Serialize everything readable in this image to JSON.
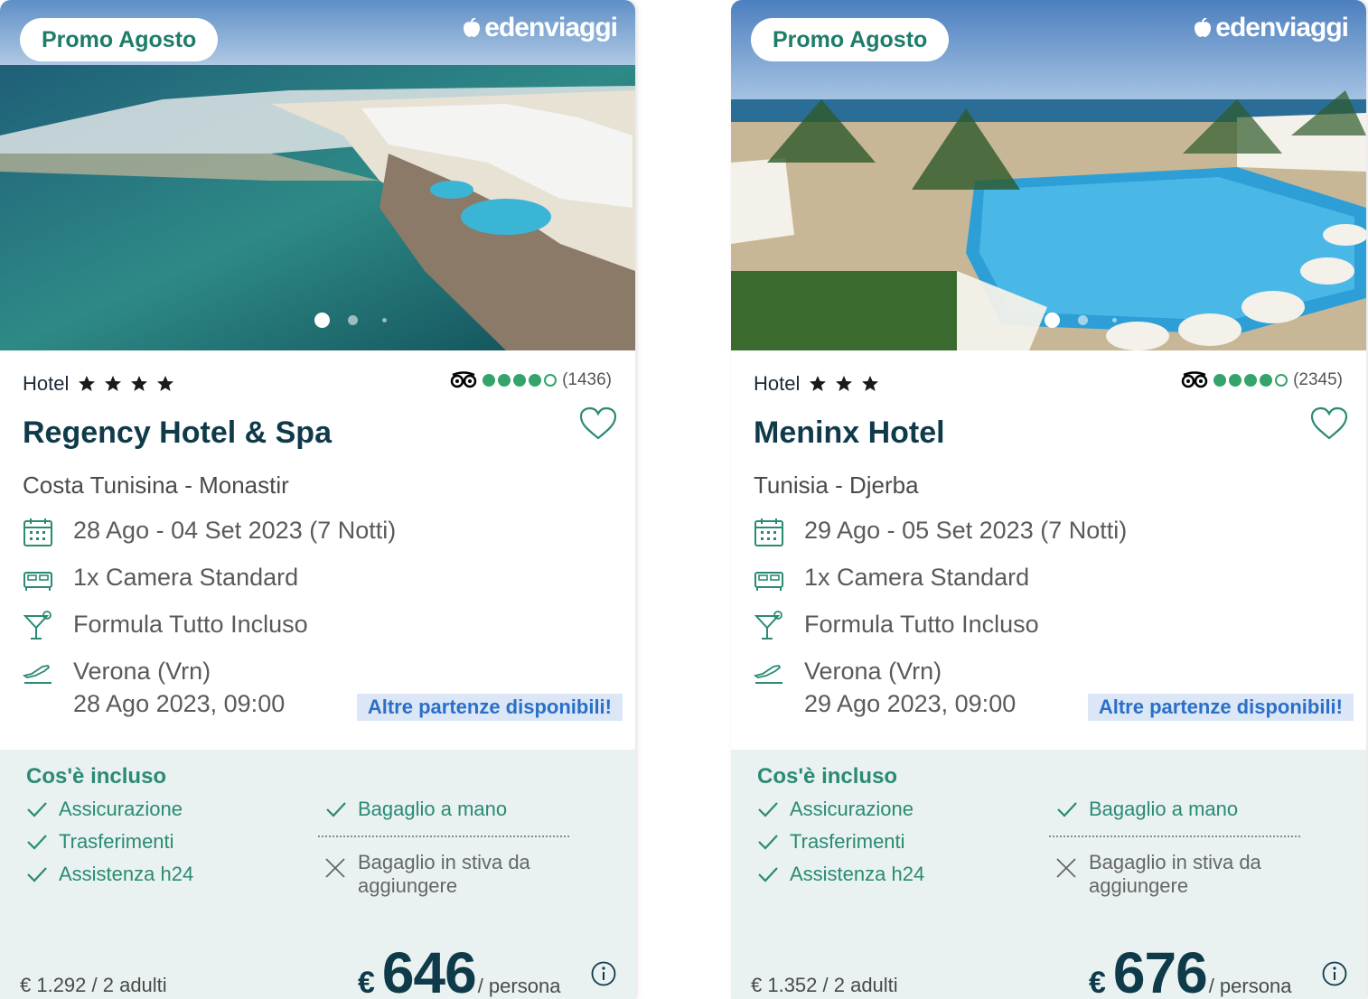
{
  "cards": [
    {
      "promo": "Promo Agosto",
      "brand": "edenviaggi",
      "hotel_label": "Hotel",
      "stars": 4,
      "ta_rating": 4,
      "ta_reviews": "(1436)",
      "name": "Regency Hotel & Spa",
      "location": "Costa Tunisina - Monastir",
      "dates": "28 Ago - 04 Set 2023 (7 Notti)",
      "room": "1x Camera Standard",
      "board": "Formula Tutto Incluso",
      "departure": "Verona (Vrn)",
      "departure_date": "28 Ago 2023, 09:00",
      "other_departures": "Altre partenze disponibili!",
      "included_title": "Cos'è incluso",
      "included": [
        "Assicurazione",
        "Trasferimenti",
        "Assistenza h24"
      ],
      "baggage_included": "Bagaglio a mano",
      "baggage_excluded": "Bagaglio in stiva da aggiungere",
      "total": "€ 1.292 / 2 adulti",
      "currency": "€",
      "price": "646",
      "price_unit": "/ persona"
    },
    {
      "promo": "Promo Agosto",
      "brand": "edenviaggi",
      "hotel_label": "Hotel",
      "stars": 3,
      "ta_rating": 4,
      "ta_reviews": "(2345)",
      "name": "Meninx Hotel",
      "location": "Tunisia - Djerba",
      "dates": "29 Ago - 05 Set 2023 (7 Notti)",
      "room": "1x Camera Standard",
      "board": "Formula Tutto Incluso",
      "departure": "Verona (Vrn)",
      "departure_date": "29 Ago 2023, 09:00",
      "other_departures": "Altre partenze disponibili!",
      "included_title": "Cos'è incluso",
      "included": [
        "Assicurazione",
        "Trasferimenti",
        "Assistenza h24"
      ],
      "baggage_included": "Bagaglio a mano",
      "baggage_excluded": "Bagaglio in stiva da aggiungere",
      "total": "€ 1.352 / 2 adulti",
      "currency": "€",
      "price": "676",
      "price_unit": "/ persona"
    }
  ],
  "colors": {
    "teal": "#2a8a74",
    "navy": "#0f3a4a",
    "tripadvisor": "#34a46a",
    "link_blue": "#2b6fc7",
    "included_bg": "#e9f2f1"
  },
  "icons": [
    "calendar-icon",
    "bed-icon",
    "cocktail-icon",
    "plane-icon",
    "heart-icon",
    "tripadvisor-owl-icon",
    "check-icon",
    "x-icon",
    "info-icon",
    "star-icon"
  ]
}
